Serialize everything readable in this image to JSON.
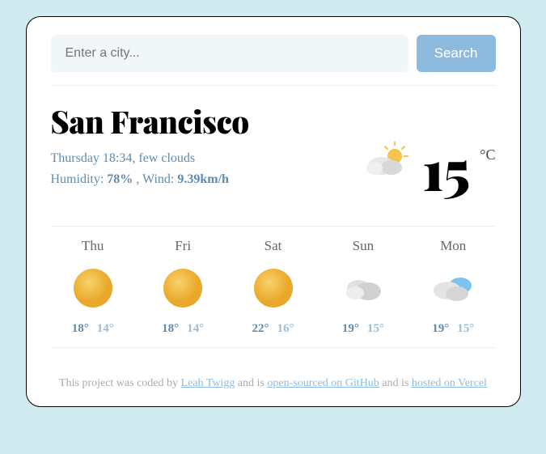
{
  "search": {
    "placeholder": "Enter a city...",
    "button_label": "Search"
  },
  "current": {
    "city": "San Francisco",
    "datetime": "Thursday 18:34",
    "condition": "few clouds",
    "humidity_label": "Humidity:",
    "humidity_value": "78%",
    "wind_label": "Wind:",
    "wind_value": "9.39km/h",
    "temperature": "15",
    "unit": "°C",
    "icon": "few-clouds"
  },
  "forecast": [
    {
      "day": "Thu",
      "icon": "clear-sky",
      "hi": "18°",
      "lo": "14°"
    },
    {
      "day": "Fri",
      "icon": "clear-sky",
      "hi": "18°",
      "lo": "14°"
    },
    {
      "day": "Sat",
      "icon": "clear-sky",
      "hi": "22°",
      "lo": "16°"
    },
    {
      "day": "Sun",
      "icon": "scattered-clouds",
      "hi": "19°",
      "lo": "15°"
    },
    {
      "day": "Mon",
      "icon": "few-clouds-day",
      "hi": "19°",
      "lo": "15°"
    }
  ],
  "footer": {
    "prefix": "This project was coded by ",
    "author": "Leah Twigg",
    "mid1": " and is ",
    "link1": "open-sourced on GitHub",
    "mid2": " and is ",
    "link2": "hosted on Vercel"
  }
}
